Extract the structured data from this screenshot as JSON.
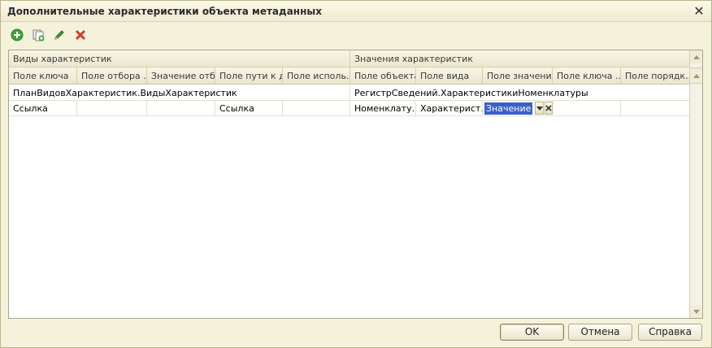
{
  "window": {
    "title": "Дополнительные характеристики объекта метаданных",
    "close_label": "✕"
  },
  "toolbar": {
    "add": "add-icon",
    "copy": "copy-icon",
    "edit": "edit-icon",
    "delete": "delete-icon"
  },
  "grid": {
    "groups": [
      "Виды характеристик",
      "Значения характеристик"
    ],
    "columns": [
      "Поле ключа",
      "Поле отбора ...",
      "Значение отб...",
      "Поле пути к д...",
      "Поле исполь...",
      "Поле объекта",
      "Поле вида",
      "Поле значения",
      "Поле ключа ...",
      "Поле порядк..."
    ],
    "row1": {
      "kinds": "ПланВидовХарактеристик.ВидыХарактеристик",
      "values": "РегистрСведений.ХарактеристикиНоменклатуры"
    },
    "row2": {
      "c1": "Ссылка",
      "c2": "",
      "c3": "",
      "c4": "Ссылка",
      "c5": "",
      "c6": "Номенклату...",
      "c7": "Характерист...",
      "c8": "Значение",
      "c9": "",
      "c10": ""
    }
  },
  "buttons": {
    "ok": "OK",
    "cancel": "Отмена",
    "help": "Справка"
  }
}
